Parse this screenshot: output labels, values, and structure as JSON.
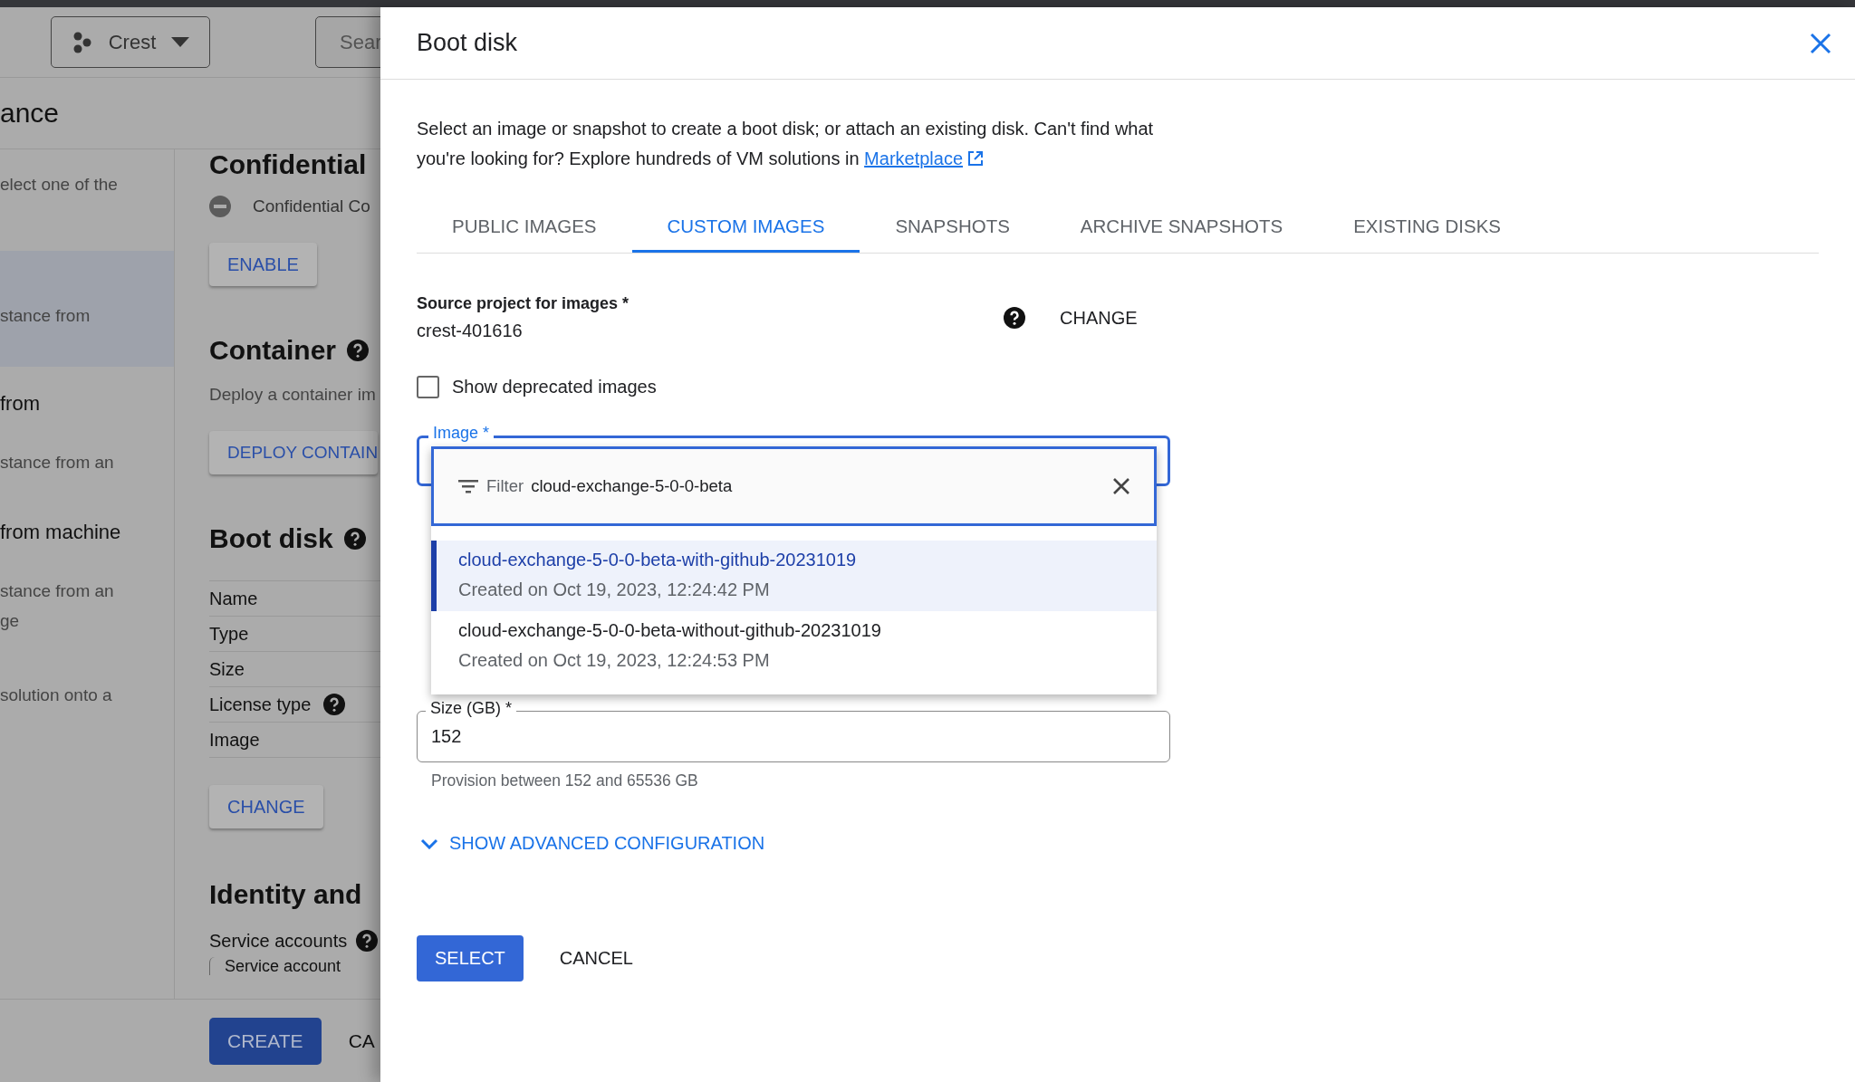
{
  "background_page": {
    "project_button": "Crest",
    "search": {
      "placeholder": "Sear"
    },
    "title": "ance",
    "nav_items": [
      {
        "description": [
          "elect one of the"
        ],
        "selected": false
      },
      {
        "description": [
          "stance from"
        ],
        "selected": true
      },
      {
        "title": "from",
        "description": [
          "stance from an"
        ],
        "selected": false
      },
      {
        "title": "from machine",
        "description": [
          "stance from an",
          "ge"
        ],
        "selected": false
      },
      {
        "description": [
          "solution onto a"
        ],
        "selected": false
      }
    ],
    "confidential": {
      "heading": "Confidential",
      "status": "Confidential Co",
      "button": "ENABLE"
    },
    "container": {
      "heading": "Container",
      "description": "Deploy a container im",
      "button": "DEPLOY CONTAIN"
    },
    "boot_disk": {
      "heading": "Boot disk",
      "rows": [
        {
          "label": "Name",
          "help": false
        },
        {
          "label": "Type",
          "help": false
        },
        {
          "label": "Size",
          "help": false
        },
        {
          "label": "License type",
          "help": true
        },
        {
          "label": "Image",
          "help": false
        }
      ],
      "button": "CHANGE"
    },
    "identity": {
      "heading": "Identity and",
      "service_accounts": "Service accounts",
      "service_account_field": "Service account"
    },
    "footer": {
      "create": "CREATE",
      "cancel": "CA"
    }
  },
  "dialog": {
    "title": "Boot disk",
    "description": "Select an image or snapshot to create a boot disk; or attach an existing disk. Can't find what you're looking for? Explore hundreds of VM solutions in ",
    "link": "Marketplace",
    "tabs": [
      {
        "label": "PUBLIC IMAGES",
        "selected": false
      },
      {
        "label": "CUSTOM IMAGES",
        "selected": true
      },
      {
        "label": "SNAPSHOTS",
        "selected": false
      },
      {
        "label": "ARCHIVE SNAPSHOTS",
        "selected": false
      },
      {
        "label": "EXISTING DISKS",
        "selected": false
      }
    ],
    "source_project": {
      "label": "Source project for images *",
      "value": "crest-401616",
      "button": "CHANGE"
    },
    "show_deprecated": {
      "label": "Show deprecated images",
      "checked": false
    },
    "image_field": {
      "label": "Image *",
      "filter_label": "Filter",
      "filter_value": "cloud-exchange-5-0-0-beta",
      "options": [
        {
          "name": "cloud-exchange-5-0-0-beta-with-github-20231019",
          "created": "Created on Oct 19, 2023, 12:24:42 PM",
          "selected": true
        },
        {
          "name": "cloud-exchange-5-0-0-beta-without-github-20231019",
          "created": "Created on Oct 19, 2023, 12:24:53 PM",
          "selected": false
        }
      ]
    },
    "size_field": {
      "label": "Size (GB) *",
      "value": "152",
      "hint": "Provision between 152 and 65536 GB"
    },
    "advanced": "SHOW ADVANCED CONFIGURATION",
    "buttons": {
      "select": "SELECT",
      "cancel": "CANCEL"
    }
  }
}
